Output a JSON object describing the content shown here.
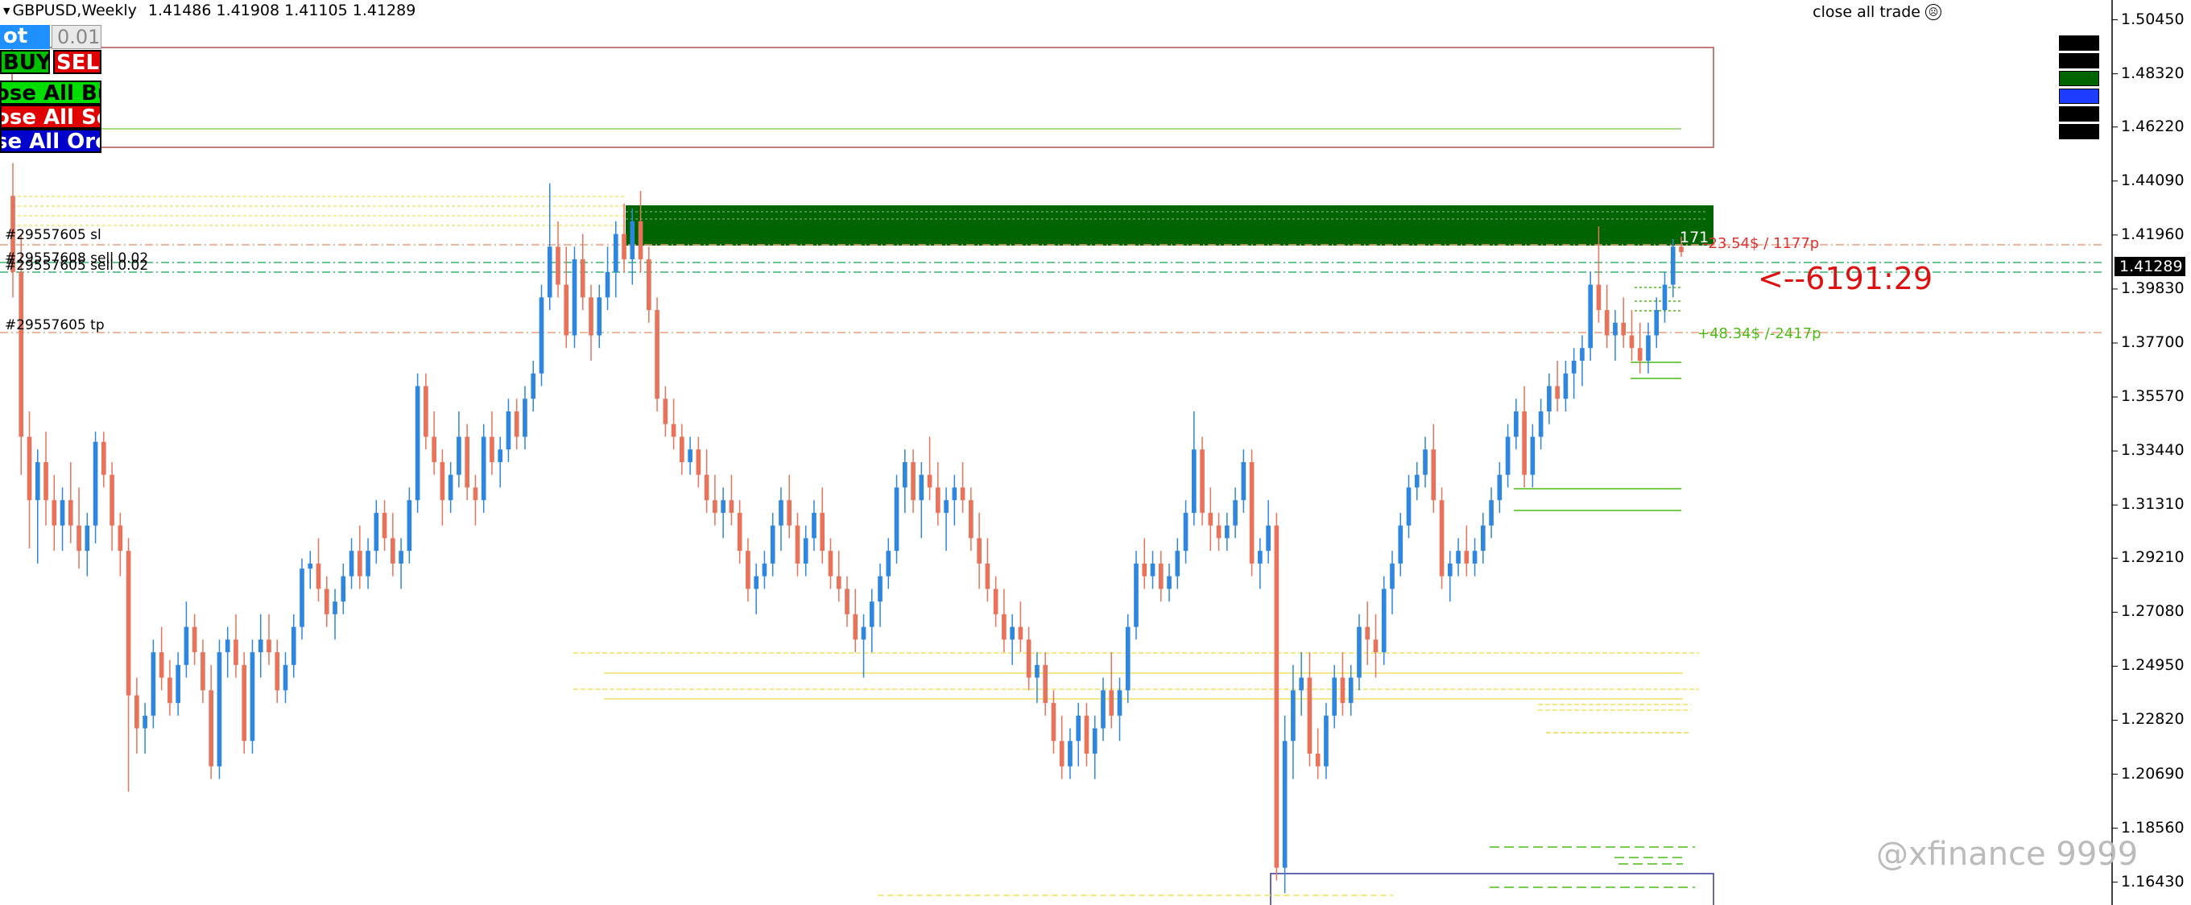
{
  "header": {
    "symbol": "GBPUSD,Weekly",
    "ohlc": "1.41486 1.41908 1.41105 1.41289"
  },
  "close_all_trade": {
    "label": "close all trade",
    "icon": "sad-face-icon"
  },
  "controls": {
    "lot_label": "ot",
    "lot_value": "0.01",
    "buy": "BUY",
    "sell": "SELL",
    "close_all_buy": "ose All Bu",
    "close_all_sell": "ose All Se",
    "close_all_orders": "se All Orc"
  },
  "orders": {
    "sl_label": "#29557605 sl",
    "sell_label_1": "#29557608 sell 0.02",
    "sell_label_2": "#29557605 sell 0.02",
    "tp_label": "#29557605 tp"
  },
  "annotations": {
    "profit_text": "+48.34$ /-2417p",
    "loss_text": "-23.54$ / 1177p",
    "timer": "<--6191:29",
    "pips_box": "171"
  },
  "price_axis": {
    "ticks": [
      "1.50450",
      "1.48320",
      "1.46220",
      "1.44090",
      "1.41960",
      "1.39830",
      "1.37700",
      "1.35570",
      "1.33440",
      "1.31310",
      "1.29210",
      "1.27080",
      "1.24950",
      "1.22820",
      "1.20690",
      "1.18560",
      "1.16430"
    ],
    "current_price": "1.41289"
  },
  "watermark": "@xfinance 9999",
  "colors": {
    "bull": "#2e86de",
    "bear": "#e8735a",
    "zone_green": "#006400",
    "tp_line": "#4cbb17",
    "sl_line": "#e03030",
    "fib": "#f0e68c"
  },
  "chart_data": {
    "type": "candlestick",
    "ylim": [
      1.1553,
      1.5123
    ],
    "candles": [
      [
        1.435,
        1.448,
        1.395,
        1.405
      ],
      [
        1.405,
        1.42,
        1.325,
        1.34
      ],
      [
        1.34,
        1.35,
        1.296,
        1.315
      ],
      [
        1.315,
        1.335,
        1.29,
        1.33
      ],
      [
        1.33,
        1.342,
        1.305,
        1.315
      ],
      [
        1.315,
        1.325,
        1.295,
        1.305
      ],
      [
        1.305,
        1.32,
        1.295,
        1.315
      ],
      [
        1.315,
        1.33,
        1.298,
        1.305
      ],
      [
        1.305,
        1.32,
        1.288,
        1.295
      ],
      [
        1.295,
        1.31,
        1.285,
        1.305
      ],
      [
        1.305,
        1.342,
        1.298,
        1.338
      ],
      [
        1.338,
        1.342,
        1.32,
        1.325
      ],
      [
        1.325,
        1.33,
        1.295,
        1.305
      ],
      [
        1.305,
        1.31,
        1.285,
        1.295
      ],
      [
        1.295,
        1.3,
        1.2,
        1.238
      ],
      [
        1.238,
        1.245,
        1.215,
        1.225
      ],
      [
        1.225,
        1.235,
        1.215,
        1.23
      ],
      [
        1.23,
        1.26,
        1.225,
        1.255
      ],
      [
        1.255,
        1.265,
        1.24,
        1.245
      ],
      [
        1.245,
        1.252,
        1.23,
        1.235
      ],
      [
        1.235,
        1.255,
        1.23,
        1.25
      ],
      [
        1.25,
        1.275,
        1.245,
        1.265
      ],
      [
        1.265,
        1.27,
        1.25,
        1.255
      ],
      [
        1.255,
        1.26,
        1.235,
        1.24
      ],
      [
        1.24,
        1.25,
        1.205,
        1.21
      ],
      [
        1.21,
        1.26,
        1.205,
        1.255
      ],
      [
        1.255,
        1.265,
        1.245,
        1.26
      ],
      [
        1.26,
        1.27,
        1.245,
        1.25
      ],
      [
        1.25,
        1.255,
        1.215,
        1.22
      ],
      [
        1.22,
        1.26,
        1.215,
        1.255
      ],
      [
        1.255,
        1.27,
        1.245,
        1.26
      ],
      [
        1.26,
        1.27,
        1.25,
        1.255
      ],
      [
        1.255,
        1.26,
        1.235,
        1.24
      ],
      [
        1.24,
        1.255,
        1.235,
        1.25
      ],
      [
        1.25,
        1.27,
        1.245,
        1.265
      ],
      [
        1.265,
        1.292,
        1.26,
        1.288
      ],
      [
        1.288,
        1.295,
        1.28,
        1.29
      ],
      [
        1.29,
        1.3,
        1.275,
        1.28
      ],
      [
        1.28,
        1.285,
        1.265,
        1.27
      ],
      [
        1.27,
        1.28,
        1.26,
        1.275
      ],
      [
        1.275,
        1.29,
        1.27,
        1.285
      ],
      [
        1.285,
        1.3,
        1.28,
        1.295
      ],
      [
        1.295,
        1.305,
        1.28,
        1.285
      ],
      [
        1.285,
        1.3,
        1.28,
        1.295
      ],
      [
        1.295,
        1.315,
        1.29,
        1.31
      ],
      [
        1.31,
        1.315,
        1.295,
        1.3
      ],
      [
        1.3,
        1.31,
        1.285,
        1.29
      ],
      [
        1.29,
        1.3,
        1.28,
        1.295
      ],
      [
        1.295,
        1.32,
        1.29,
        1.315
      ],
      [
        1.315,
        1.365,
        1.31,
        1.36
      ],
      [
        1.36,
        1.365,
        1.335,
        1.34
      ],
      [
        1.34,
        1.35,
        1.325,
        1.33
      ],
      [
        1.33,
        1.335,
        1.305,
        1.315
      ],
      [
        1.315,
        1.33,
        1.31,
        1.325
      ],
      [
        1.325,
        1.35,
        1.32,
        1.34
      ],
      [
        1.34,
        1.345,
        1.315,
        1.32
      ],
      [
        1.32,
        1.325,
        1.305,
        1.315
      ],
      [
        1.315,
        1.345,
        1.31,
        1.34
      ],
      [
        1.34,
        1.35,
        1.325,
        1.33
      ],
      [
        1.33,
        1.34,
        1.32,
        1.335
      ],
      [
        1.335,
        1.355,
        1.33,
        1.35
      ],
      [
        1.35,
        1.355,
        1.335,
        1.34
      ],
      [
        1.34,
        1.36,
        1.335,
        1.355
      ],
      [
        1.355,
        1.37,
        1.35,
        1.365
      ],
      [
        1.365,
        1.4,
        1.36,
        1.395
      ],
      [
        1.395,
        1.44,
        1.39,
        1.415
      ],
      [
        1.415,
        1.425,
        1.395,
        1.4
      ],
      [
        1.4,
        1.415,
        1.375,
        1.38
      ],
      [
        1.38,
        1.415,
        1.375,
        1.41
      ],
      [
        1.41,
        1.42,
        1.39,
        1.395
      ],
      [
        1.395,
        1.4,
        1.37,
        1.38
      ],
      [
        1.38,
        1.4,
        1.375,
        1.395
      ],
      [
        1.395,
        1.415,
        1.39,
        1.405
      ],
      [
        1.405,
        1.425,
        1.395,
        1.42
      ],
      [
        1.42,
        1.432,
        1.405,
        1.41
      ],
      [
        1.41,
        1.43,
        1.4,
        1.425
      ],
      [
        1.425,
        1.437,
        1.405,
        1.41
      ],
      [
        1.41,
        1.415,
        1.385,
        1.39
      ],
      [
        1.39,
        1.395,
        1.35,
        1.355
      ],
      [
        1.355,
        1.36,
        1.34,
        1.345
      ],
      [
        1.345,
        1.355,
        1.335,
        1.34
      ],
      [
        1.34,
        1.345,
        1.325,
        1.33
      ],
      [
        1.33,
        1.34,
        1.325,
        1.335
      ],
      [
        1.335,
        1.34,
        1.32,
        1.325
      ],
      [
        1.325,
        1.335,
        1.31,
        1.315
      ],
      [
        1.315,
        1.325,
        1.305,
        1.31
      ],
      [
        1.31,
        1.32,
        1.3,
        1.315
      ],
      [
        1.315,
        1.325,
        1.305,
        1.31
      ],
      [
        1.31,
        1.315,
        1.29,
        1.295
      ],
      [
        1.295,
        1.3,
        1.275,
        1.28
      ],
      [
        1.28,
        1.29,
        1.27,
        1.285
      ],
      [
        1.285,
        1.295,
        1.28,
        1.29
      ],
      [
        1.29,
        1.31,
        1.285,
        1.305
      ],
      [
        1.305,
        1.32,
        1.295,
        1.315
      ],
      [
        1.315,
        1.325,
        1.3,
        1.305
      ],
      [
        1.305,
        1.31,
        1.285,
        1.29
      ],
      [
        1.29,
        1.305,
        1.285,
        1.3
      ],
      [
        1.3,
        1.315,
        1.295,
        1.31
      ],
      [
        1.31,
        1.32,
        1.29,
        1.295
      ],
      [
        1.295,
        1.3,
        1.28,
        1.285
      ],
      [
        1.285,
        1.295,
        1.275,
        1.28
      ],
      [
        1.28,
        1.285,
        1.265,
        1.27
      ],
      [
        1.27,
        1.28,
        1.255,
        1.26
      ],
      [
        1.26,
        1.27,
        1.245,
        1.265
      ],
      [
        1.265,
        1.28,
        1.255,
        1.275
      ],
      [
        1.275,
        1.29,
        1.265,
        1.285
      ],
      [
        1.285,
        1.3,
        1.28,
        1.295
      ],
      [
        1.295,
        1.325,
        1.29,
        1.32
      ],
      [
        1.32,
        1.335,
        1.31,
        1.33
      ],
      [
        1.33,
        1.335,
        1.31,
        1.315
      ],
      [
        1.315,
        1.33,
        1.3,
        1.325
      ],
      [
        1.325,
        1.34,
        1.315,
        1.32
      ],
      [
        1.32,
        1.33,
        1.305,
        1.31
      ],
      [
        1.31,
        1.32,
        1.295,
        1.315
      ],
      [
        1.315,
        1.325,
        1.305,
        1.32
      ],
      [
        1.32,
        1.33,
        1.31,
        1.315
      ],
      [
        1.315,
        1.32,
        1.295,
        1.3
      ],
      [
        1.3,
        1.31,
        1.28,
        1.29
      ],
      [
        1.29,
        1.3,
        1.275,
        1.28
      ],
      [
        1.28,
        1.285,
        1.265,
        1.27
      ],
      [
        1.27,
        1.28,
        1.255,
        1.26
      ],
      [
        1.26,
        1.27,
        1.25,
        1.265
      ],
      [
        1.265,
        1.275,
        1.255,
        1.26
      ],
      [
        1.26,
        1.265,
        1.24,
        1.245
      ],
      [
        1.245,
        1.255,
        1.235,
        1.25
      ],
      [
        1.25,
        1.255,
        1.23,
        1.235
      ],
      [
        1.235,
        1.24,
        1.215,
        1.22
      ],
      [
        1.22,
        1.23,
        1.205,
        1.21
      ],
      [
        1.21,
        1.225,
        1.205,
        1.22
      ],
      [
        1.22,
        1.235,
        1.21,
        1.23
      ],
      [
        1.23,
        1.235,
        1.21,
        1.215
      ],
      [
        1.215,
        1.23,
        1.205,
        1.225
      ],
      [
        1.225,
        1.245,
        1.22,
        1.24
      ],
      [
        1.24,
        1.255,
        1.225,
        1.23
      ],
      [
        1.23,
        1.245,
        1.22,
        1.24
      ],
      [
        1.24,
        1.27,
        1.235,
        1.265
      ],
      [
        1.265,
        1.295,
        1.26,
        1.29
      ],
      [
        1.29,
        1.3,
        1.28,
        1.285
      ],
      [
        1.285,
        1.295,
        1.28,
        1.29
      ],
      [
        1.29,
        1.295,
        1.275,
        1.28
      ],
      [
        1.28,
        1.29,
        1.275,
        1.285
      ],
      [
        1.285,
        1.3,
        1.28,
        1.295
      ],
      [
        1.295,
        1.315,
        1.29,
        1.31
      ],
      [
        1.31,
        1.35,
        1.305,
        1.335
      ],
      [
        1.335,
        1.34,
        1.305,
        1.31
      ],
      [
        1.31,
        1.32,
        1.295,
        1.305
      ],
      [
        1.305,
        1.31,
        1.295,
        1.3
      ],
      [
        1.3,
        1.31,
        1.295,
        1.305
      ],
      [
        1.305,
        1.32,
        1.3,
        1.315
      ],
      [
        1.315,
        1.335,
        1.31,
        1.33
      ],
      [
        1.33,
        1.335,
        1.285,
        1.29
      ],
      [
        1.29,
        1.3,
        1.28,
        1.295
      ],
      [
        1.295,
        1.315,
        1.29,
        1.305
      ],
      [
        1.305,
        1.31,
        1.165,
        1.17
      ],
      [
        1.17,
        1.23,
        1.16,
        1.22
      ],
      [
        1.22,
        1.25,
        1.205,
        1.24
      ],
      [
        1.24,
        1.255,
        1.23,
        1.245
      ],
      [
        1.245,
        1.255,
        1.21,
        1.215
      ],
      [
        1.215,
        1.225,
        1.205,
        1.21
      ],
      [
        1.21,
        1.235,
        1.205,
        1.23
      ],
      [
        1.23,
        1.25,
        1.225,
        1.245
      ],
      [
        1.245,
        1.255,
        1.23,
        1.235
      ],
      [
        1.235,
        1.25,
        1.23,
        1.245
      ],
      [
        1.245,
        1.27,
        1.24,
        1.265
      ],
      [
        1.265,
        1.275,
        1.25,
        1.26
      ],
      [
        1.26,
        1.27,
        1.245,
        1.255
      ],
      [
        1.255,
        1.285,
        1.25,
        1.28
      ],
      [
        1.28,
        1.295,
        1.27,
        1.29
      ],
      [
        1.29,
        1.31,
        1.285,
        1.305
      ],
      [
        1.305,
        1.325,
        1.3,
        1.32
      ],
      [
        1.32,
        1.33,
        1.315,
        1.325
      ],
      [
        1.325,
        1.34,
        1.32,
        1.335
      ],
      [
        1.335,
        1.345,
        1.31,
        1.315
      ],
      [
        1.315,
        1.32,
        1.28,
        1.285
      ],
      [
        1.285,
        1.295,
        1.275,
        1.29
      ],
      [
        1.29,
        1.3,
        1.285,
        1.295
      ],
      [
        1.295,
        1.305,
        1.285,
        1.29
      ],
      [
        1.29,
        1.3,
        1.285,
        1.295
      ],
      [
        1.295,
        1.31,
        1.29,
        1.305
      ],
      [
        1.305,
        1.32,
        1.3,
        1.315
      ],
      [
        1.315,
        1.33,
        1.31,
        1.325
      ],
      [
        1.325,
        1.345,
        1.32,
        1.34
      ],
      [
        1.34,
        1.355,
        1.335,
        1.35
      ],
      [
        1.35,
        1.36,
        1.32,
        1.325
      ],
      [
        1.325,
        1.345,
        1.32,
        1.34
      ],
      [
        1.34,
        1.355,
        1.335,
        1.35
      ],
      [
        1.35,
        1.365,
        1.345,
        1.36
      ],
      [
        1.36,
        1.37,
        1.35,
        1.355
      ],
      [
        1.355,
        1.37,
        1.35,
        1.365
      ],
      [
        1.365,
        1.375,
        1.355,
        1.37
      ],
      [
        1.37,
        1.38,
        1.36,
        1.375
      ],
      [
        1.375,
        1.405,
        1.37,
        1.4
      ],
      [
        1.4,
        1.423,
        1.385,
        1.39
      ],
      [
        1.39,
        1.4,
        1.375,
        1.38
      ],
      [
        1.38,
        1.39,
        1.37,
        1.385
      ],
      [
        1.385,
        1.395,
        1.375,
        1.38
      ],
      [
        1.38,
        1.39,
        1.37,
        1.375
      ],
      [
        1.375,
        1.385,
        1.365,
        1.37
      ],
      [
        1.37,
        1.385,
        1.365,
        1.38
      ],
      [
        1.38,
        1.395,
        1.375,
        1.39
      ],
      [
        1.39,
        1.405,
        1.385,
        1.4
      ],
      [
        1.4,
        1.418,
        1.395,
        1.415
      ],
      [
        1.415,
        1.419,
        1.411,
        1.4129
      ]
    ]
  }
}
